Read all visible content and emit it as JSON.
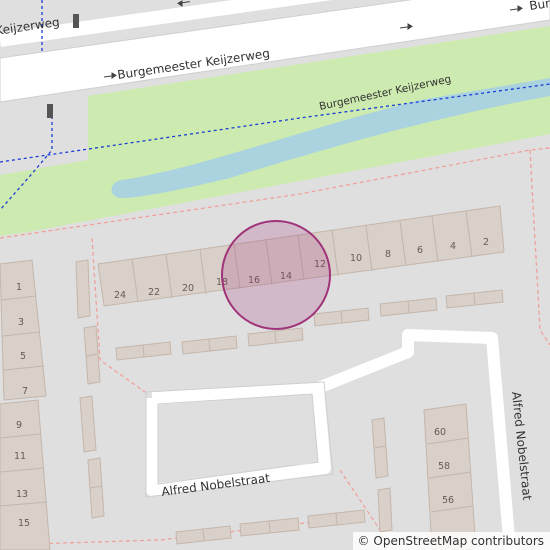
{
  "map": {
    "streets": {
      "main_road_top": "Burgemeester Keijzerweg",
      "main_road_top_left_fragment": "Keijzerweg",
      "main_road_top_right_fragment": "Bur",
      "canal_road": "Burgemeester Keijzerweg",
      "nobelstraat_bottom": "Alfred Nobelstraat",
      "nobelstraat_right": "Alfred Nobelstraat"
    },
    "house_numbers": {
      "north_row": [
        "24",
        "22",
        "20",
        "18",
        "16",
        "14",
        "12",
        "10",
        "8",
        "6",
        "4",
        "2"
      ],
      "west_column": [
        "1",
        "3",
        "5",
        "7",
        "9",
        "11",
        "13",
        "15"
      ],
      "east_column": [
        "60",
        "58",
        "56"
      ]
    },
    "marker": {
      "type": "location-circle",
      "color": "#a0347a"
    },
    "colors": {
      "background": "#e0dfdf",
      "building": "#d9d0c9",
      "building_outline": "#c4b6ab",
      "grass": "#cdebb0",
      "water": "#aad3df",
      "road": "#ffffff",
      "boundary": "#f0a09a",
      "path": "#1a3ed4"
    }
  },
  "attribution": {
    "symbol": "©",
    "text": "OpenStreetMap contributors"
  }
}
